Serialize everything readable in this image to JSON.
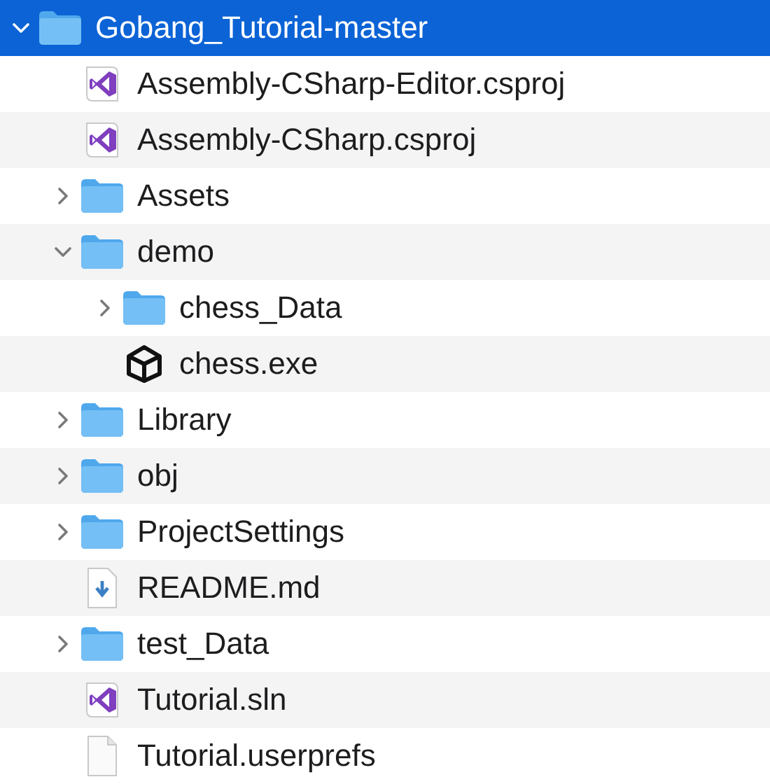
{
  "tree": [
    {
      "name": "Gobang_Tutorial-master",
      "kind": "folder",
      "expanded": true,
      "selected": true,
      "children": [
        {
          "name": "Assembly-CSharp-Editor.csproj",
          "kind": "vs",
          "selected": false
        },
        {
          "name": "Assembly-CSharp.csproj",
          "kind": "vs",
          "selected": false
        },
        {
          "name": "Assets",
          "kind": "folder",
          "expanded": false,
          "selected": false
        },
        {
          "name": "demo",
          "kind": "folder",
          "expanded": true,
          "selected": false,
          "children": [
            {
              "name": "chess_Data",
              "kind": "folder",
              "expanded": false,
              "selected": false
            },
            {
              "name": "chess.exe",
              "kind": "unity",
              "selected": false
            }
          ]
        },
        {
          "name": "Library",
          "kind": "folder",
          "expanded": false,
          "selected": false
        },
        {
          "name": "obj",
          "kind": "folder",
          "expanded": false,
          "selected": false
        },
        {
          "name": "ProjectSettings",
          "kind": "folder",
          "expanded": false,
          "selected": false
        },
        {
          "name": "README.md",
          "kind": "markdown",
          "selected": false
        },
        {
          "name": "test_Data",
          "kind": "folder",
          "expanded": false,
          "selected": false
        },
        {
          "name": "Tutorial.sln",
          "kind": "vs",
          "selected": false
        },
        {
          "name": "Tutorial.userprefs",
          "kind": "file",
          "selected": false
        }
      ]
    }
  ]
}
